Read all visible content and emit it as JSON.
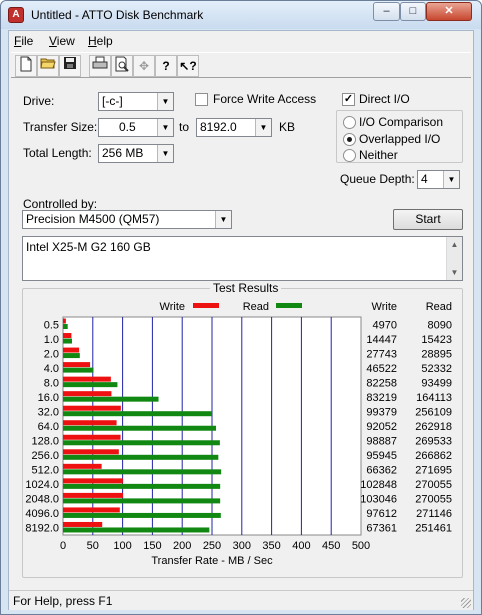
{
  "window": {
    "title": "Untitled - ATTO Disk Benchmark",
    "minimize": "–",
    "maximize": "□",
    "close": "✕"
  },
  "menu": {
    "file": {
      "label": "File",
      "accel": "F",
      "rest": "ile"
    },
    "view": {
      "label": "View",
      "accel": "V",
      "rest": "iew"
    },
    "help": {
      "label": "Help",
      "accel": "H",
      "rest": "elp"
    }
  },
  "toolbar": {
    "buttons": [
      "new-icon",
      "open-icon",
      "save-icon",
      "print-icon",
      "print-preview-icon",
      "move-icon",
      "help-icon",
      "context-help-icon"
    ]
  },
  "drive": {
    "label": "Drive:",
    "value": "[-c-]"
  },
  "force_write": {
    "label": "Force Write Access",
    "checked": false
  },
  "direct_io": {
    "label": "Direct I/O",
    "checked": true
  },
  "transfer_size": {
    "label": "Transfer Size:",
    "from": "0.5",
    "to_label": "to",
    "to": "8192.0",
    "unit": "KB"
  },
  "total_length": {
    "label": "Total Length:",
    "value": "256 MB"
  },
  "io_mode": {
    "options": [
      "I/O Comparison",
      "Overlapped I/O",
      "Neither"
    ],
    "selected": "Overlapped I/O"
  },
  "queue_depth": {
    "label": "Queue Depth:",
    "value": "4"
  },
  "controlled_by": {
    "label": "Controlled by:",
    "value": "Precision M4500 (QM57)"
  },
  "start_button": "Start",
  "description": "Intel X25-M G2 160 GB",
  "results": {
    "title": "Test Results"
  },
  "status": "For Help, press F1",
  "colors": {
    "write": "#ee1111",
    "read": "#118811",
    "grid": "#2222aa"
  },
  "chart_data": {
    "type": "bar",
    "orientation": "horizontal",
    "xlabel": "Transfer Rate - MB / Sec",
    "xlim": [
      0,
      500
    ],
    "xticks": [
      0,
      50,
      100,
      150,
      200,
      250,
      300,
      350,
      400,
      450,
      500
    ],
    "grid": true,
    "legend_position": "top",
    "table_headers": [
      "Write",
      "Read"
    ],
    "categories": [
      "0.5",
      "1.0",
      "2.0",
      "4.0",
      "8.0",
      "16.0",
      "32.0",
      "64.0",
      "128.0",
      "256.0",
      "512.0",
      "1024.0",
      "2048.0",
      "4096.0",
      "8192.0"
    ],
    "series": [
      {
        "name": "Write",
        "color": "#ee1111",
        "values": [
          4970,
          14447,
          27743,
          46522,
          82258,
          83219,
          99379,
          92052,
          98887,
          95945,
          66362,
          102848,
          103046,
          97612,
          67361
        ],
        "labels": [
          "4970",
          "14447",
          "27743",
          "46522",
          "82258",
          "83219",
          "99379",
          "92052",
          "98887",
          "95945",
          "66362",
          "102848",
          "103046",
          "97612",
          "67361"
        ]
      },
      {
        "name": "Read",
        "color": "#118811",
        "values": [
          8090,
          15423,
          28895,
          52332,
          93499,
          164113,
          256109,
          262918,
          269533,
          266862,
          271695,
          270055,
          270055,
          271146,
          251461
        ],
        "labels": [
          "8090",
          "15423",
          "28895",
          "52332",
          "93499",
          "164113",
          "256109",
          "262918",
          "269533",
          "266862",
          "271695",
          "270055",
          "270055",
          "271146",
          "251461"
        ]
      }
    ]
  }
}
